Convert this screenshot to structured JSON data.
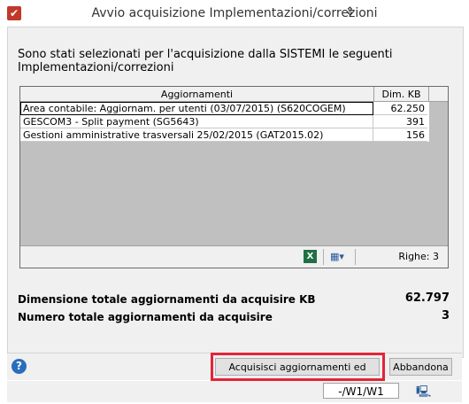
{
  "window": {
    "title": "Avvio acquisizione Implementazioni/correzioni"
  },
  "intro_text": "Sono stati selezionati per l'acquisizione dalla SISTEMI le seguenti Implementazioni/correzioni",
  "grid": {
    "columns": [
      "Aggiornamenti",
      "Dim. KB"
    ],
    "rows": [
      {
        "name": "Area contabile: Aggiornam. per utenti (03/07/2015) (S620COGEM)",
        "size": "62.250"
      },
      {
        "name": "GESCOM3 - Split payment (SG5643)",
        "size": "391"
      },
      {
        "name": "Gestioni amministrative trasversali 25/02/2015 (GAT2015.02)",
        "size": "156"
      }
    ],
    "row_count_label": "Righe: 3"
  },
  "summary": {
    "total_size_label": "Dimensione totale aggiornamenti da acquisire KB",
    "total_size_value": "62.797",
    "total_count_label": "Numero totale aggiornamenti da acquisire",
    "total_count_value": "3"
  },
  "buttons": {
    "acquire_install": "Acquisisci aggiornamenti ed installa",
    "abandon": "Abbandona"
  },
  "status": {
    "field": "-/W1/W1"
  },
  "icons": {
    "app": "app-icon",
    "help": "help-icon",
    "excel": "excel-export-icon",
    "config": "grid-config-icon",
    "monitor": "monitor-icon"
  },
  "colors": {
    "highlight": "#e2243a",
    "panel": "#f0f0f0",
    "grid_empty": "#c0c0c0"
  }
}
